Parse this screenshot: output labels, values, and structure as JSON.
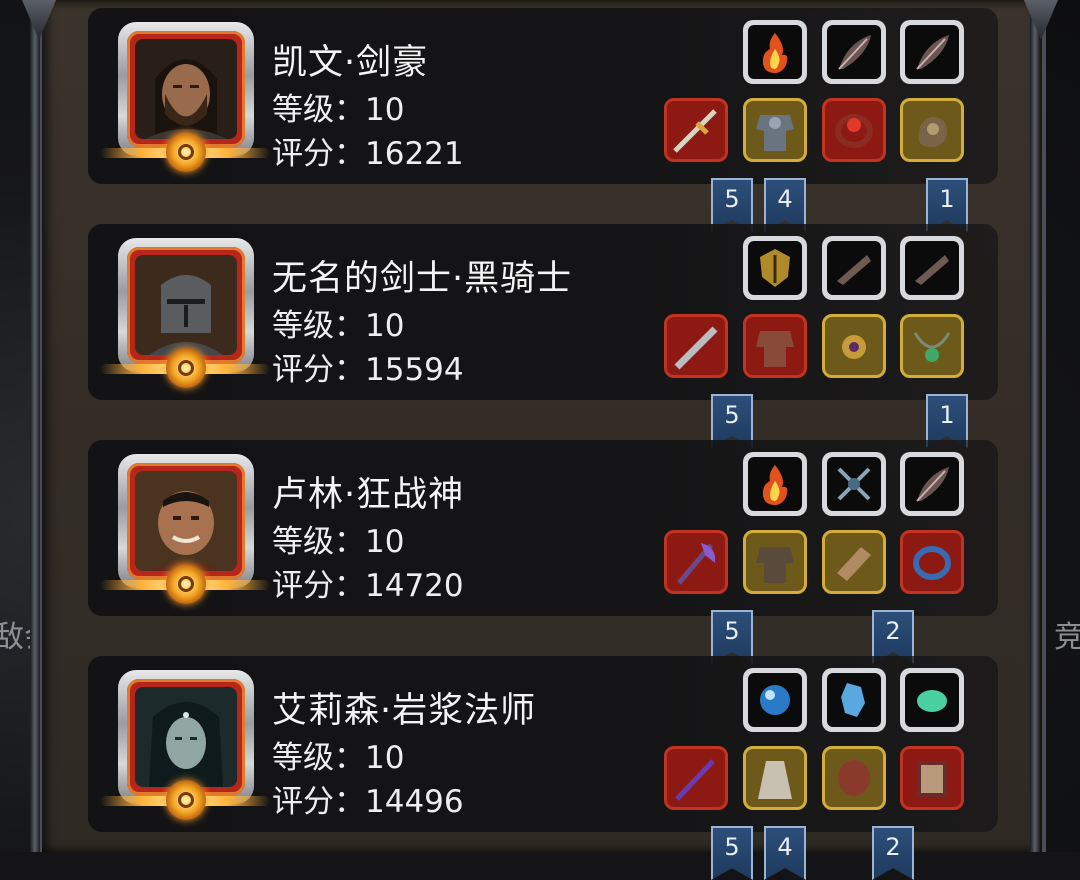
{
  "side_labels": {
    "left": "敌会",
    "right": "竞"
  },
  "heroes": [
    {
      "name": "凯文·剑豪",
      "level": "等级：10",
      "score": "评分：16221",
      "portrait_icon": "long-haired-warrior-portrait",
      "top_slots": [
        "fire-skill-icon",
        "feather-skill-icon",
        "feather-skill-icon"
      ],
      "equip_slots": [
        "sword-icon",
        "armor-icon",
        "ring-icon",
        "gauntlet-icon"
      ],
      "ribbons": [
        "5",
        "4",
        "1"
      ]
    },
    {
      "name": "无名的剑士·黑骑士",
      "level": "等级：10",
      "score": "评分：15594",
      "portrait_icon": "iron-helmet-portrait",
      "top_slots": [
        "golden-shield-skill-icon",
        "blade-skill-icon",
        "blade-skill-icon"
      ],
      "equip_slots": [
        "greatsword-icon",
        "plate-armor-icon",
        "amulet-icon",
        "necklace-icon"
      ],
      "ribbons": [
        "5",
        "1"
      ]
    },
    {
      "name": "卢林·狂战神",
      "level": "等级：10",
      "score": "评分：14720",
      "portrait_icon": "berserker-portrait",
      "top_slots": [
        "fire-skill-icon",
        "crossed-weapons-skill-icon",
        "feather-skill-icon"
      ],
      "equip_slots": [
        "axe-icon",
        "chest-armor-icon",
        "bracer-icon",
        "ring-icon"
      ],
      "ribbons": [
        "5",
        "2"
      ]
    },
    {
      "name": "艾莉森·岩浆法师",
      "level": "等级：10",
      "score": "评分：14496",
      "portrait_icon": "hooded-mage-portrait",
      "top_slots": [
        "orb-skill-icon",
        "ice-crystal-skill-icon",
        "jade-stone-skill-icon"
      ],
      "equip_slots": [
        "staff-icon",
        "robe-icon",
        "bracer-icon",
        "spellbook-icon"
      ],
      "ribbons": [
        "5",
        "4",
        "2"
      ]
    }
  ],
  "colors": {
    "panel": "#332d26",
    "card": "#141416",
    "ribbon": "#2c4f7a",
    "rank_glow": "#ffb23a"
  }
}
